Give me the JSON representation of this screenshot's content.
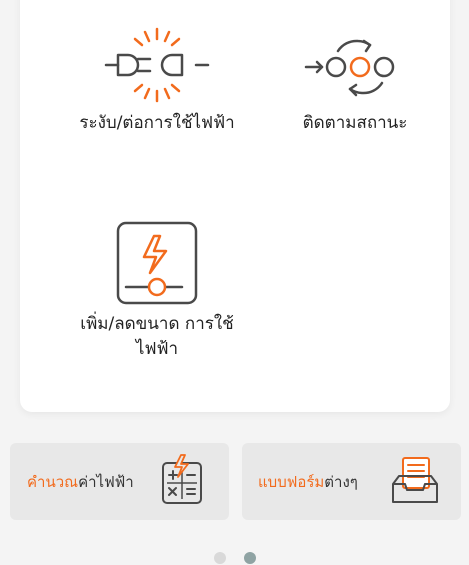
{
  "services": [
    {
      "label": "ระงับ/ต่อการใช้ไฟฟ้า",
      "icon": "plug-disconnect-icon"
    },
    {
      "label": "ติดตามสถานะ",
      "icon": "status-tracking-icon"
    },
    {
      "label": "เพิ่ม/ลดขนาด การใช้ไฟฟ้า",
      "icon": "meter-adjust-icon"
    }
  ],
  "tiles": [
    {
      "highlight": "คำนวณ",
      "rest": "ค่าไฟฟ้า",
      "icon": "calculator-icon"
    },
    {
      "highlight": "แบบฟอร์ม",
      "rest": "ต่างๆ",
      "icon": "document-tray-icon"
    }
  ],
  "pagination": {
    "total": 2,
    "active": 1
  },
  "colors": {
    "accent": "#f26b1d",
    "icon": "#4a4a4a",
    "dot_inactive": "#d9d9d9",
    "dot_active": "#8fa3a3"
  }
}
